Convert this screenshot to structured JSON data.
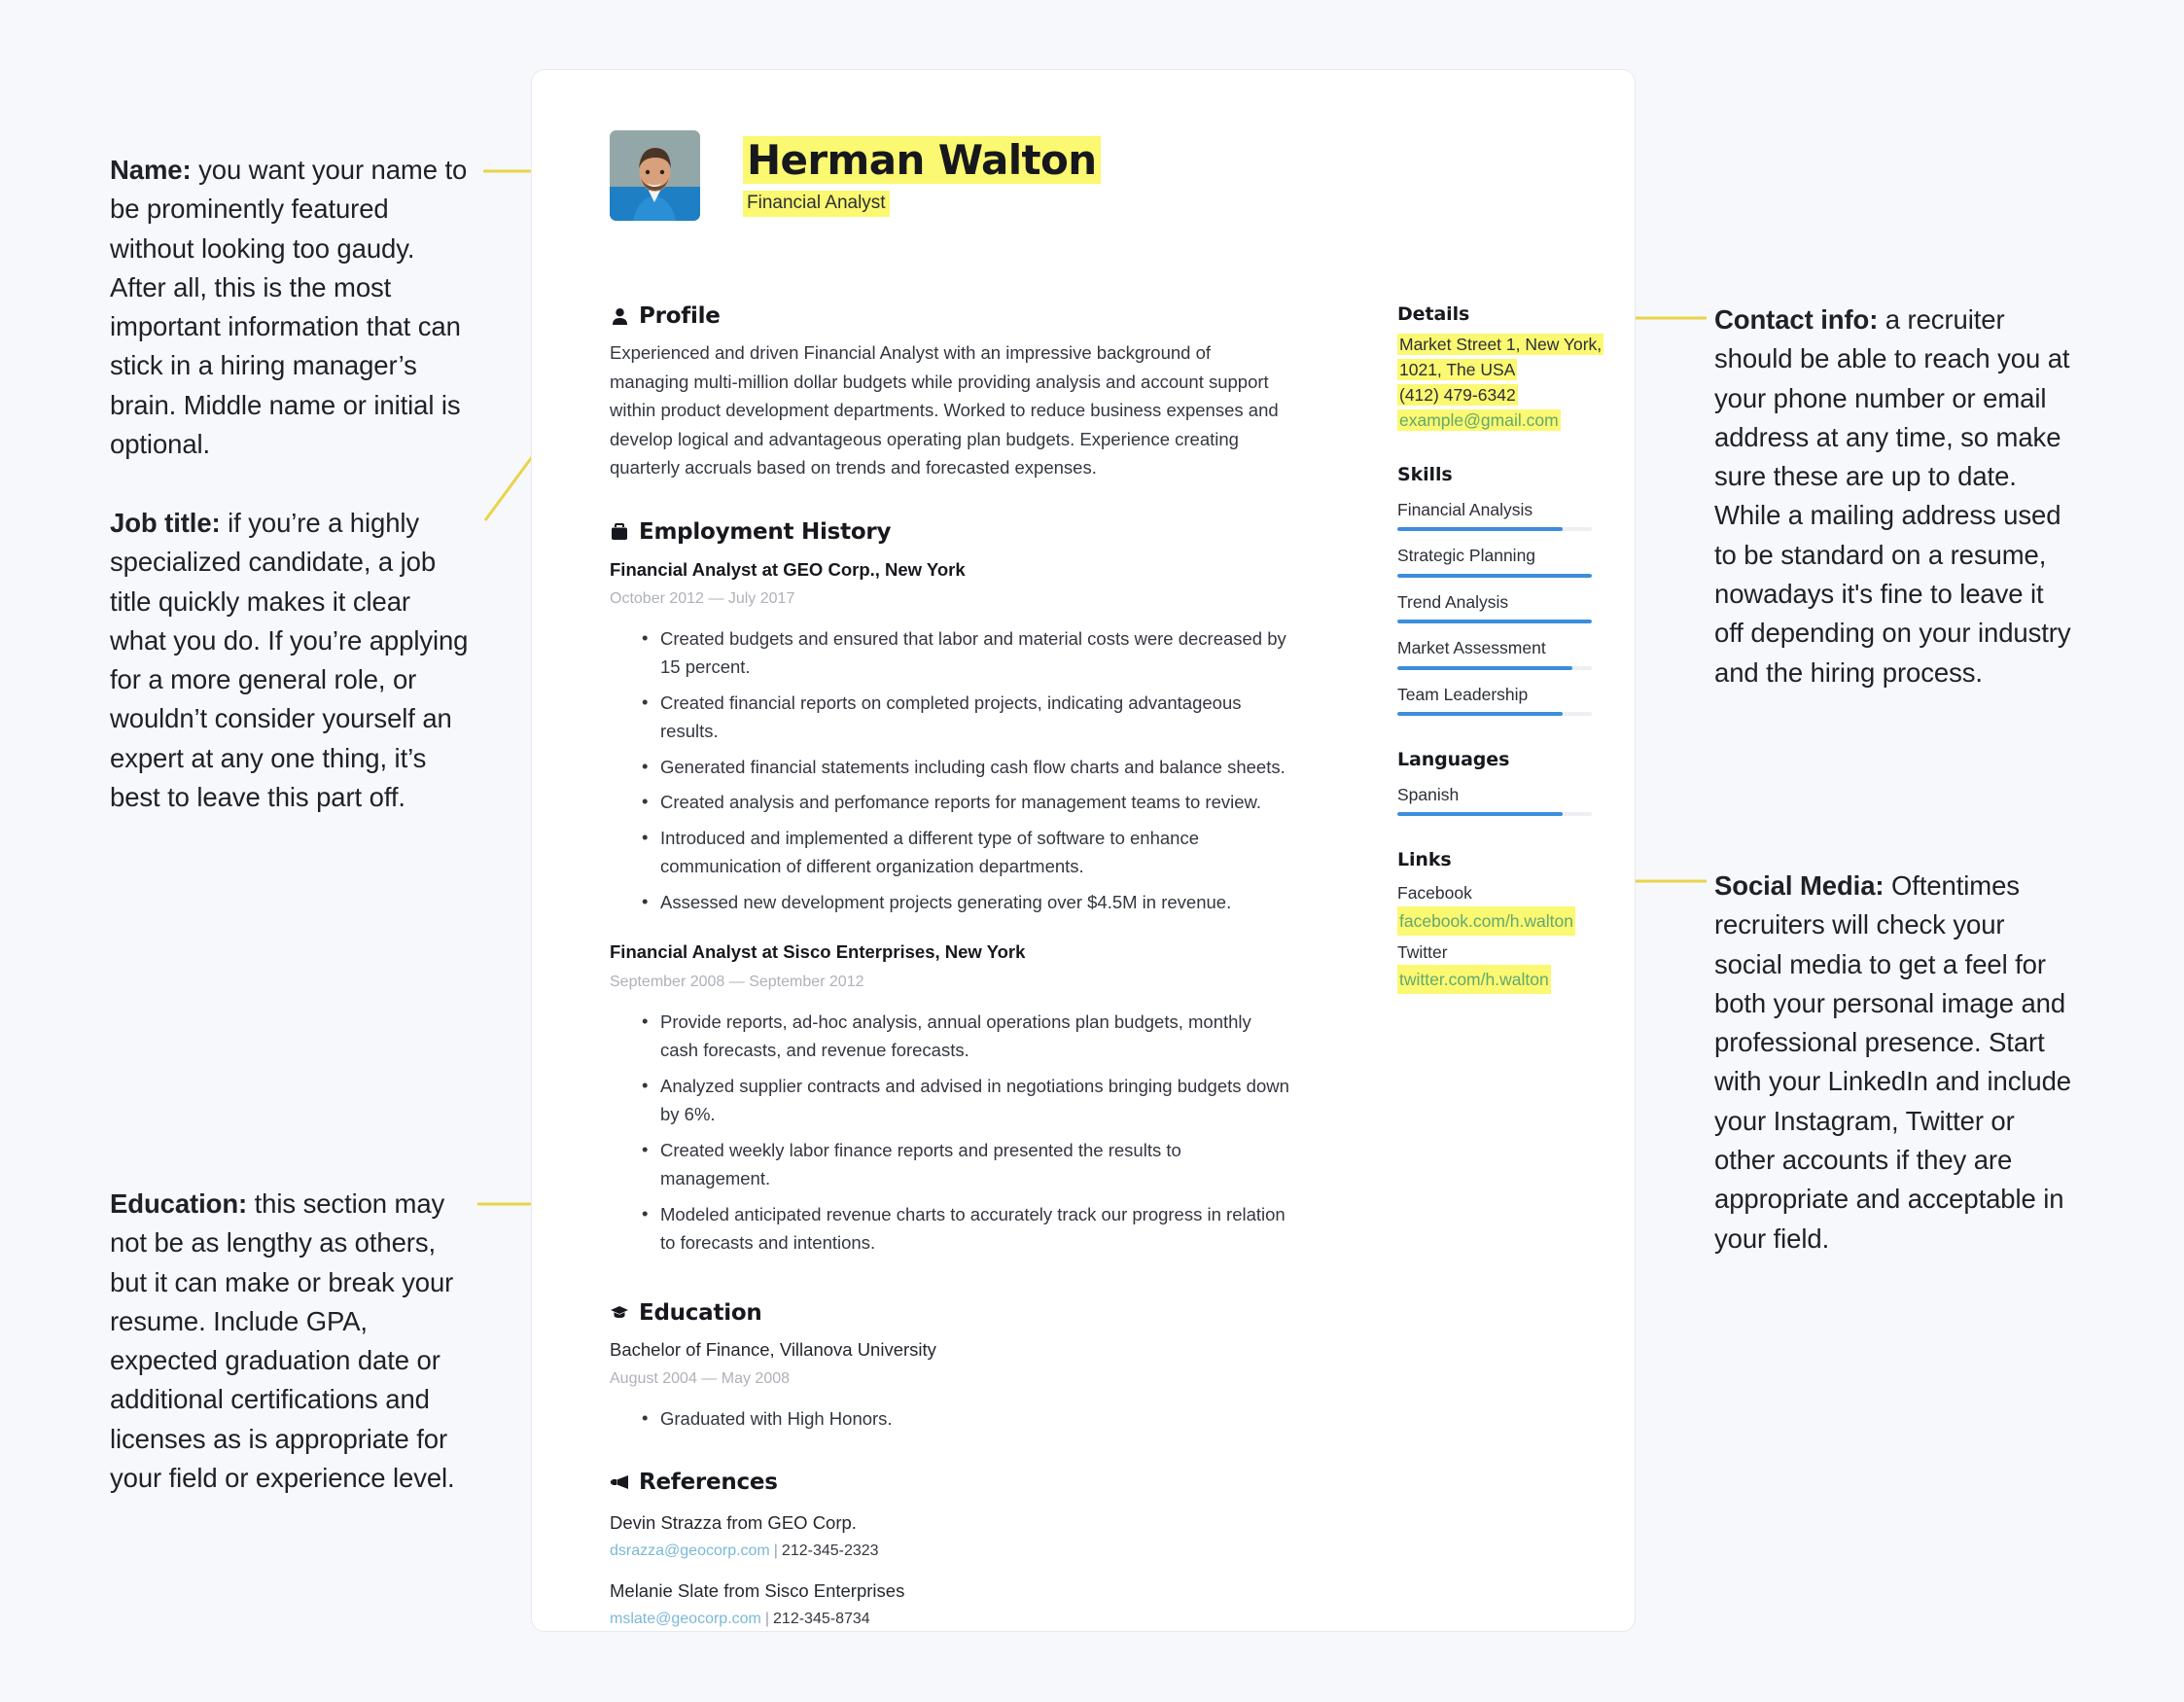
{
  "colors": {
    "page_background": "#f7f8fc",
    "card_background": "#ffffff",
    "highlight_yellow": "#fbf871",
    "connector_yellow": "#e8d44a",
    "skill_bar": "#3c8ddc",
    "link_green": "#63a96f",
    "ref_mail_blue": "#7ab9d6"
  },
  "annotations": [
    {
      "id": "name",
      "title": "Name:",
      "body": " you want your name to be prominently featured without looking too gaudy. After all, this is the most important information that can stick in a hiring manager’s brain. Middle name or initial is optional."
    },
    {
      "id": "job-title",
      "title": "Job title:",
      "body": " if you’re a highly specialized candidate, a job title quickly makes it clear what you do. If you’re applying for a more general role, or wouldn’t consider yourself an expert at any one thing, it’s best to leave this part off."
    },
    {
      "id": "education",
      "title": "Education:",
      "body": " this section may not be as lengthy as others, but it can make or break your resume. Include GPA, expected graduation date or additional certifications and licenses as is appropriate for your field or experience level."
    },
    {
      "id": "contact-info",
      "title": "Contact info:",
      "body": " a recruiter should be able to reach you at your phone number or email address at any time, so make sure these are up to date. While a mailing address used to be standard on a resume, nowadays it's fine to leave it off depending on your industry and the hiring process."
    },
    {
      "id": "social-media",
      "title": "Social Media:",
      "body": " Oftentimes recruiters will check your social media to get a feel for both your personal image and professional presence. Start with your LinkedIn and include your Instagram, Twitter or other accounts if they are appropriate and acceptable in your field."
    }
  ],
  "resume": {
    "header": {
      "name": "Herman Walton",
      "job_title": "Financial Analyst",
      "avatar_alt": "photo of applicant"
    },
    "profile": {
      "heading": "Profile",
      "icon": "person-icon",
      "text": "Experienced and driven Financial Analyst with an impressive background of managing multi-million dollar budgets while providing analysis and account support within product development departments. Worked to reduce business expenses and develop logical and advantageous operating plan budgets. Experience creating quarterly accruals based on trends and forecasted expenses."
    },
    "employment": {
      "heading": "Employment History",
      "icon": "briefcase-icon",
      "jobs": [
        {
          "title": "Financial Analyst at GEO Corp., New York",
          "dates": "October 2012 — July 2017",
          "bullets": [
            "Created budgets and ensured that labor and material costs were decreased by 15 percent.",
            "Created financial reports on completed projects, indicating advantageous results.",
            "Generated financial statements including cash flow charts and balance sheets.",
            "Created analysis and perfomance reports for management teams to review.",
            "Introduced and implemented a different type of software to enhance communication of different organization departments.",
            "Assessed new development projects generating over $4.5M in revenue."
          ]
        },
        {
          "title": "Financial Analyst at Sisco Enterprises, New York",
          "dates": "September 2008 — September 2012",
          "bullets": [
            "Provide reports, ad-hoc analysis, annual operations plan budgets, monthly cash forecasts, and revenue forecasts.",
            "Analyzed supplier contracts and advised in negotiations bringing budgets down by 6%.",
            "Created weekly labor finance reports and presented the results to management.",
            "Modeled anticipated revenue charts to accurately track our progress in relation to forecasts and intentions."
          ]
        }
      ]
    },
    "education": {
      "heading": "Education",
      "icon": "graduation-cap-icon",
      "degree": "Bachelor of Finance, Villanova University",
      "dates": "August 2004 — May 2008",
      "bullets": [
        "Graduated with High Honors."
      ]
    },
    "references": {
      "heading": "References",
      "icon": "megaphone-icon",
      "items": [
        {
          "name": "Devin Strazza from GEO Corp.",
          "email": "dsrazza@geocorp.com",
          "separator": "|",
          "phone": "212-345-2323"
        },
        {
          "name": "Melanie Slate from Sisco Enterprises",
          "email": "mslate@geocorp.com",
          "separator": "|",
          "phone": "212-345-8734"
        }
      ]
    },
    "sidebar": {
      "details": {
        "heading": "Details",
        "address_line1": "Market Street 1, New York,",
        "address_line2": "1021, The USA",
        "phone": "(412) 479-6342",
        "email": "example@gmail.com"
      },
      "skills": {
        "heading": "Skills",
        "items": [
          {
            "label": "Financial Analysis",
            "level": 85
          },
          {
            "label": "Strategic Planning",
            "level": 100
          },
          {
            "label": "Trend Analysis",
            "level": 100
          },
          {
            "label": "Market Assessment",
            "level": 90
          },
          {
            "label": "Team Leadership",
            "level": 85
          }
        ]
      },
      "languages": {
        "heading": "Languages",
        "items": [
          {
            "label": "Spanish",
            "level": 85
          }
        ]
      },
      "links": {
        "heading": "Links",
        "items": [
          {
            "label": "Facebook",
            "url": "facebook.com/h.walton"
          },
          {
            "label": "Twitter",
            "url": "twitter.com/h.walton"
          }
        ]
      }
    }
  }
}
